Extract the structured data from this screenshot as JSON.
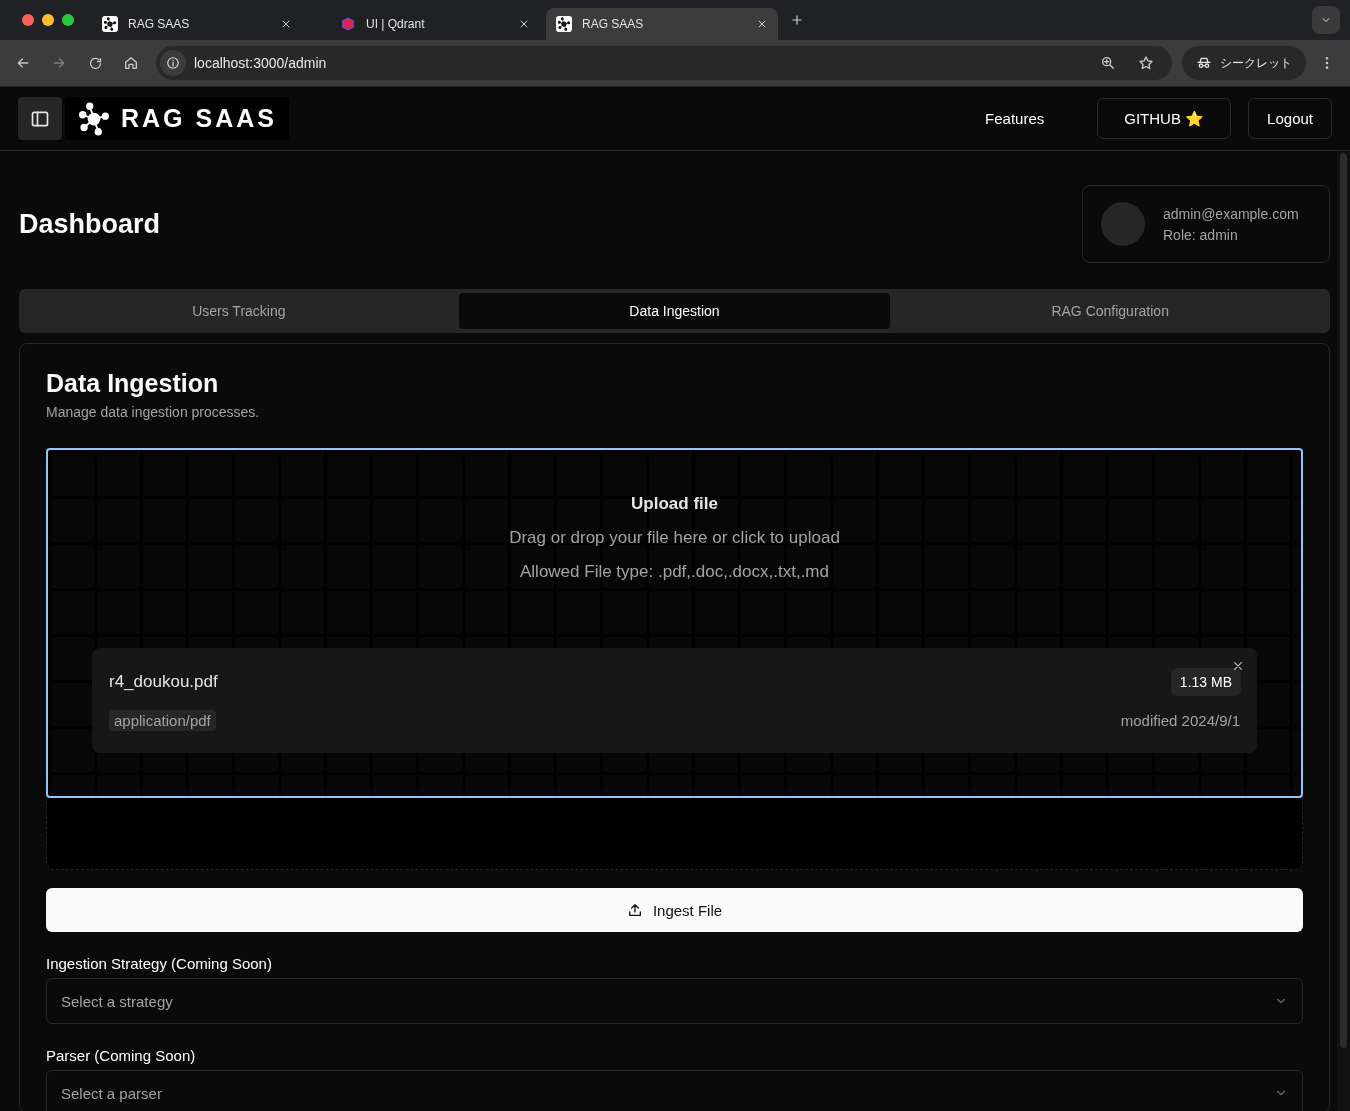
{
  "browser": {
    "tabs": [
      {
        "title": "RAG SAAS",
        "kind": "app",
        "selected": false
      },
      {
        "title": "UI | Qdrant",
        "kind": "db",
        "selected": false
      },
      {
        "title": "RAG SAAS",
        "kind": "app",
        "selected": true
      }
    ],
    "url": "localhost:3000/admin",
    "profile": "シークレット"
  },
  "header": {
    "logo": "RAG SAAS",
    "nav": [
      {
        "label": "Features",
        "kind": "link"
      },
      {
        "label": "GITHUB ⭐",
        "kind": "outlined"
      },
      {
        "label": "Logout",
        "kind": "outlined"
      }
    ]
  },
  "page": {
    "title": "Dashboard",
    "user": {
      "email": "admin@example.com",
      "role": "Role: admin"
    }
  },
  "tabs": [
    {
      "label": "Users Tracking",
      "selected": false
    },
    {
      "label": "Data Ingestion",
      "selected": true
    },
    {
      "label": "RAG Configuration",
      "selected": false
    }
  ],
  "card": {
    "title": "Data Ingestion",
    "subtitle": "Manage data ingestion processes.",
    "upload": {
      "title": "Upload file",
      "hint": "Drag or drop your file here or click to upload",
      "types": "Allowed File type: .pdf,.doc,.docx,.txt,.md"
    },
    "file": {
      "name": "r4_doukou.pdf",
      "size": "1.13 MB",
      "type": "application/pdf",
      "modified": "modified 2024/9/1"
    },
    "button": "Ingest File",
    "selects": [
      {
        "label": "Ingestion Strategy (Coming Soon)",
        "placeholder": "Select a strategy"
      },
      {
        "label": "Parser (Coming Soon)",
        "placeholder": "Select a parser"
      }
    ]
  }
}
